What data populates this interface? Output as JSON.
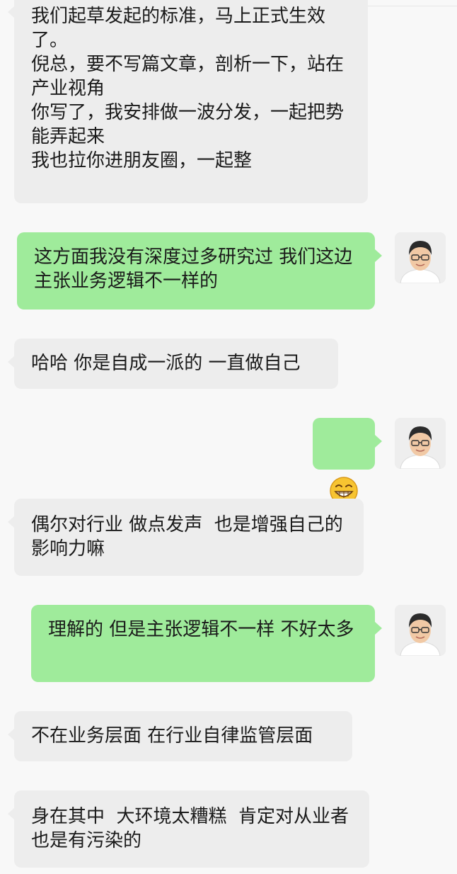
{
  "colors": {
    "background": "#f8f8f8",
    "incoming_bubble": "#ededed",
    "outgoing_bubble": "#9feb9b",
    "text": "#1a1a1a"
  },
  "messages": [
    {
      "direction": "in",
      "text": "我们起草发起的标准，马上正式生效了。\n倪总，要不写篇文章，剖析一下，站在产业视角\n你写了，我安排做一波分发，一起把势能弄起来\n我也拉你进朋友圈，一起整"
    },
    {
      "direction": "out",
      "text": "这方面我没有深度过多研究过 我们这边主张业务逻辑不一样的",
      "avatar": "user-avatar"
    },
    {
      "direction": "in",
      "text": "哈哈 你是自成一派的 一直做自己"
    },
    {
      "direction": "out",
      "emoji": "grinning-face-emoji",
      "avatar": "user-avatar"
    },
    {
      "direction": "in",
      "text": "偶尔对行业 做点发声  也是增强自己的影响力嘛"
    },
    {
      "direction": "out",
      "text": "理解的 但是主张逻辑不一样 不好太多",
      "avatar": "user-avatar"
    },
    {
      "direction": "in",
      "text": "不在业务层面 在行业自律监管层面"
    },
    {
      "direction": "in",
      "text": "身在其中  大环境太糟糕  肯定对从业者也是有污染的"
    }
  ]
}
